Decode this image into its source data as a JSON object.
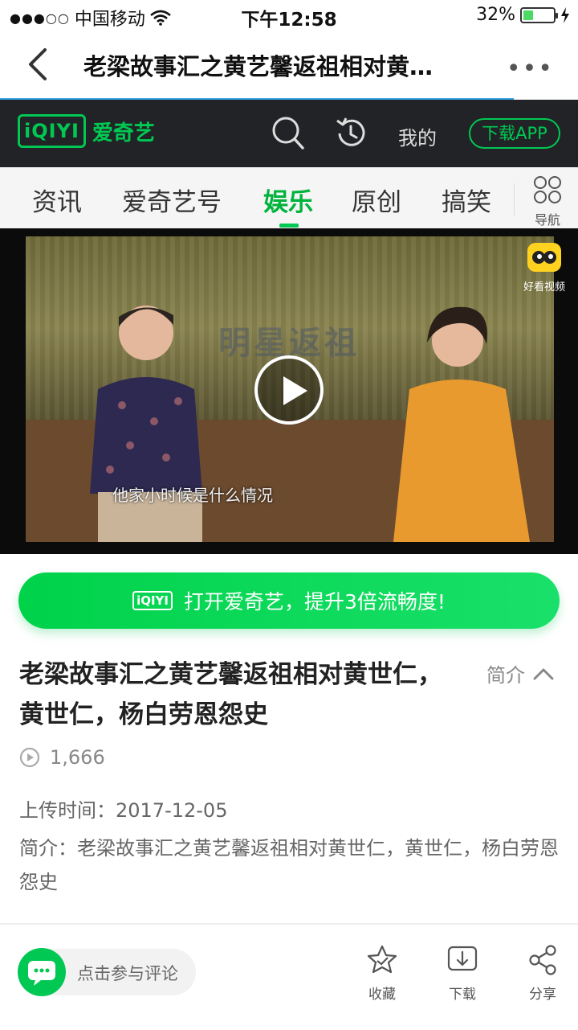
{
  "status_bar": {
    "signal_dots": "●●●○○",
    "carrier": "中国移动",
    "time": "下午12:58",
    "battery_percent": "32%",
    "battery_level": 0.32
  },
  "nav": {
    "title": "老梁故事汇之黄艺馨返祖相对黄…",
    "more": "•••"
  },
  "iqiyi_header": {
    "logo_badge": "iQIYI",
    "logo_name": "爱奇艺",
    "mine": "我的",
    "download_app": "下载APP",
    "brand_color": "#00c853"
  },
  "tabs": [
    {
      "label": "资讯",
      "active": false
    },
    {
      "label": "爱奇艺号",
      "active": false
    },
    {
      "label": "娱乐",
      "active": true
    },
    {
      "label": "原创",
      "active": false
    },
    {
      "label": "搞笑",
      "active": false
    }
  ],
  "nav_button_label": "导航",
  "video": {
    "subtitle": "他家小时候是什么情况",
    "watermark": "明星返祖",
    "haokan_label": "好看视频"
  },
  "open_app": {
    "logo": "iQIYI",
    "text": "打开爱奇艺，提升3倍流畅度!"
  },
  "details": {
    "title": "老梁故事汇之黄艺馨返祖相对黄世仁，黄世仁，杨白劳恩怨史",
    "intro_toggle": "简介",
    "views": "1,666",
    "upload_time": "上传时间：2017-12-05",
    "description": "简介：老梁故事汇之黄艺馨返祖相对黄世仁，黄世仁，杨白劳恩怨史"
  },
  "bottom_bar": {
    "comment_placeholder": "点击参与评论",
    "actions": [
      {
        "label": "收藏",
        "icon": "favorite-star-icon"
      },
      {
        "label": "下载",
        "icon": "download-icon"
      },
      {
        "label": "分享",
        "icon": "share-icon"
      }
    ]
  }
}
